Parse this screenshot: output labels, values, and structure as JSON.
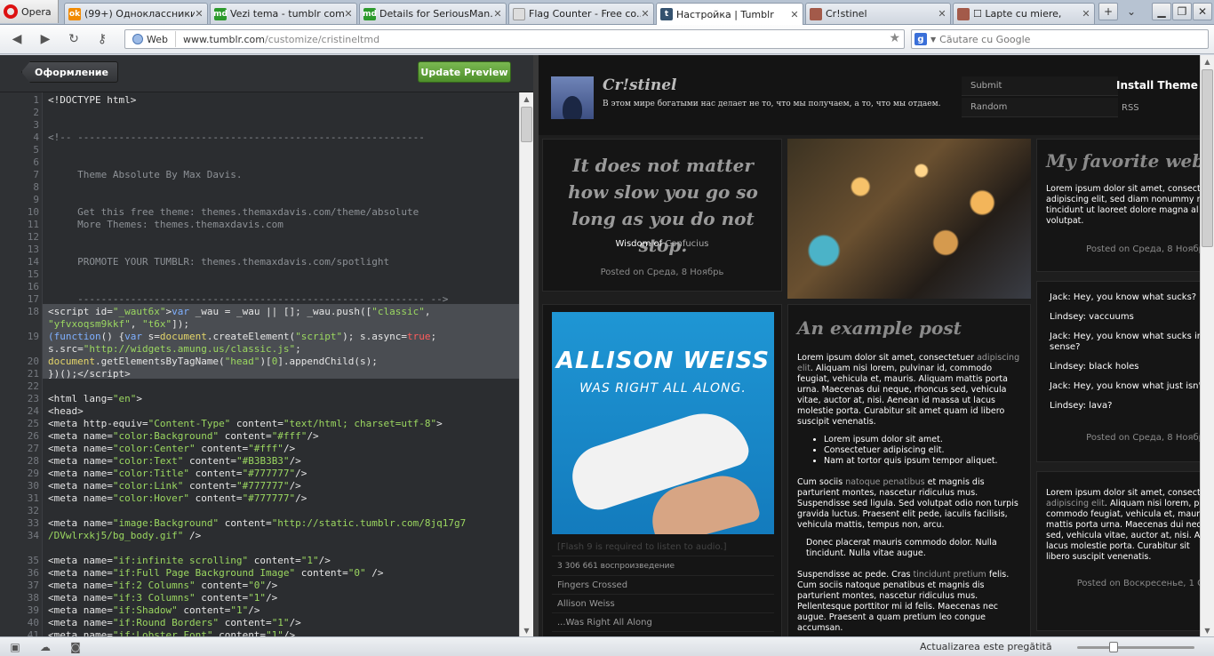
{
  "browser": {
    "menu_label": "Opera",
    "tabs": [
      {
        "title": "(99+) Одноклассники",
        "favicon": "odnoklassniki-icon"
      },
      {
        "title": "Vezi tema - tumblr com...",
        "favicon": "md-icon"
      },
      {
        "title": "Details for SeriousMan...",
        "favicon": "md-icon"
      },
      {
        "title": "Flag Counter - Free co...",
        "favicon": "page-icon"
      },
      {
        "title": "Настройка | Tumblr",
        "favicon": "tumblr-icon",
        "active": true
      },
      {
        "title": "Cr!stinel",
        "favicon": "image-icon"
      },
      {
        "title": "☐ Lapte cu miere,",
        "favicon": "image-icon"
      }
    ],
    "web_label": "Web",
    "url_host": "www.tumblr.com",
    "url_path": "/customize/cristineltmd",
    "url_prefix": "www.",
    "search_placeholder": "Căutare cu Google",
    "status_text": "Actualizarea este pregătită"
  },
  "editor": {
    "back_label": "Оформление",
    "update_label": "Update Preview",
    "line_numbers": [
      "1",
      "2",
      "3",
      "4",
      "5",
      "6",
      "7",
      "8",
      "9",
      "10",
      "11",
      "12",
      "13",
      "14",
      "15",
      "16",
      "17",
      "18",
      "",
      "19",
      "",
      "20",
      "21",
      "22",
      "23",
      "24",
      "25",
      "26",
      "27",
      "28",
      "29",
      "30",
      "31",
      "32",
      "33",
      "34",
      "",
      "35",
      "36",
      "37",
      "38",
      "39",
      "40",
      "41",
      "42"
    ]
  },
  "preview": {
    "blog_title": "Cr!stinel",
    "blog_description": "В этом мире богатыми нас делает не то, что мы получаем, а то, что мы отдаем.",
    "nav": {
      "submit": "Submit",
      "random": "Random",
      "rss": "RSS",
      "install_theme": "Install Theme"
    },
    "quote_post": {
      "text": "It does not matter how slow you go so long as you do not stop.",
      "source_prefix": "Wisdom of",
      "source_name": "Confucius",
      "posted": "Posted on Среда, 8 Ноябрь"
    },
    "text_post_right": {
      "title": "My favorite web si",
      "body": "Lorem ipsum dolor sit amet, consect adipiscing elit, sed diam nonummy n tincidunt ut laoreet dolore magna al volutpat.",
      "posted": "Posted on Среда, 8 Ноябр"
    },
    "chat_post": {
      "lines": [
        "Jack: Hey, you know what sucks?",
        "Lindsey: vaccuums",
        "Jack: Hey, you know what sucks in a",
        "sense?",
        "Lindsey: black holes",
        "Jack: Hey, you know what just isn't c",
        "Lindsey: lava?"
      ],
      "posted": "Posted on Среда, 8 Ноябр"
    },
    "audio_post": {
      "album_line1": "ALLISON WEISS",
      "album_line2": "WAS RIGHT ALL ALONG.",
      "flash_note": "[Flash 9 is required to listen to audio.]",
      "plays": "3 306 661 воспроизведение",
      "track": "Fingers Crossed",
      "artist": "Allison Weiss",
      "album": "...Was Right All Along"
    },
    "example_post": {
      "title": "An example post",
      "intro_pre": "Lorem ipsum dolor sit amet, consectetuer",
      "intro_link": "adipiscing elit",
      "intro_post": ". Aliquam nisi lorem, pulvinar id, commodo feugiat, vehicula et, mauris. Aliquam mattis porta urna. Maecenas dui neque, rhoncus sed, vehicula vitae, auctor at, nisi. Aenean id massa ut lacus molestie porta. Curabitur sit amet quam id libero suscipit venenatis.",
      "bullets": [
        "Lorem ipsum dolor sit amet.",
        "Consectetuer adipiscing elit.",
        "Nam at tortor quis ipsum tempor aliquet."
      ],
      "para2_pre": "Cum sociis",
      "para2_link": "natoque penatibus",
      "para2_post": "et magnis dis parturient montes, nascetur ridiculus mus. Suspendisse sed ligula. Sed volutpat odio non turpis gravida luctus. Praesent elit pede, iaculis facilisis, vehicula mattis, tempus non, arcu.",
      "blockquote": "Donec placerat mauris commodo dolor. Nulla tincidunt. Nulla vitae augue.",
      "para3_pre": "Suspendisse ac pede. Cras",
      "para3_link": "tincidunt pretium",
      "para3_post": "felis. Cum sociis natoque penatibus et magnis dis parturient montes, nascetur ridiculus mus. Pellentesque porttitor mi id felis. Maecenas nec augue. Praesent a quam pretium leo congue accumsan."
    },
    "text_post_right2": {
      "pre": "Lorem ipsum dolor sit amet, consect",
      "link": "adipiscing elit",
      "post": ". Aliquam nisi lorem, p commodo feugiat, vehicula et, mauris mattis porta urna. Maecenas dui neq sed, vehicula vitae, auctor at, nisi. A ut lacus molestie porta. Curabitur sit libero suscipit venenatis.",
      "posted": "Posted on Воскресенье, 1 О"
    }
  },
  "colors": {
    "accent_green": "#5a9e34",
    "editor_bg": "#2b2d30",
    "string_green": "#9bd760"
  }
}
